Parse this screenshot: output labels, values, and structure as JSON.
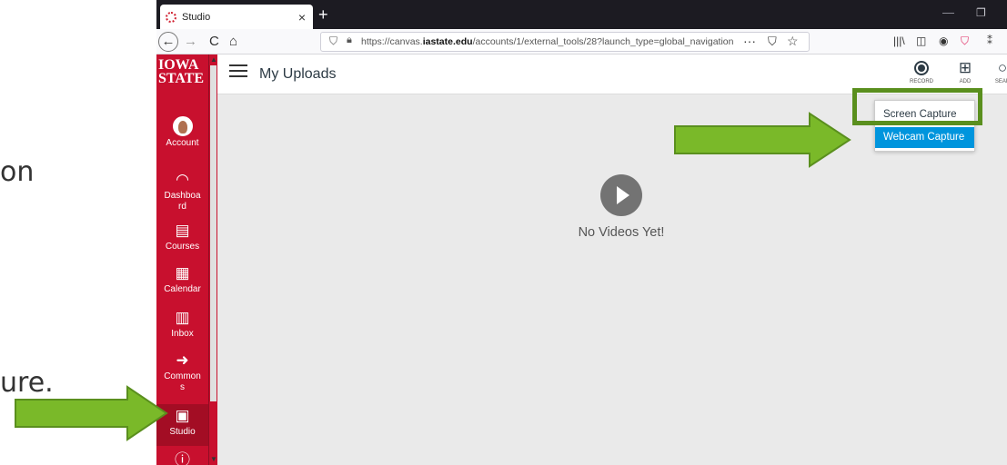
{
  "slide": {
    "fragment_top": "on",
    "fragment_bottom": "ure."
  },
  "browser": {
    "tab_title": "Studio",
    "tab_close": "×",
    "new_tab": "+",
    "min": "—",
    "max": "❐",
    "nav": {
      "back": "←",
      "forward": "→",
      "reload": "C",
      "home": "⌂"
    },
    "url_prefix": "https://canvas.",
    "url_domain": "iastate.edu",
    "url_suffix": "/accounts/1/external_tools/28?launch_type=global_navigation",
    "url_more": "···",
    "toolbar_icons": [
      "library-icon",
      "sidebar-icon",
      "account-icon",
      "pocket-icon",
      "extension-icon"
    ]
  },
  "canvas_nav": {
    "logo_line1": "IOWA",
    "logo_line2": "STATE",
    "items": [
      {
        "label": "Account",
        "icon": "avatar"
      },
      {
        "label": "Dashboa\nrd",
        "icon": "dashboard-icon"
      },
      {
        "label": "Courses",
        "icon": "courses-icon"
      },
      {
        "label": "Calendar",
        "icon": "calendar-icon"
      },
      {
        "label": "Inbox",
        "icon": "inbox-icon"
      },
      {
        "label": "Common\ns",
        "icon": "commons-icon"
      },
      {
        "label": "Studio",
        "icon": "studio-icon"
      },
      {
        "label": "",
        "icon": "help-icon"
      }
    ]
  },
  "header": {
    "title": "My Uploads",
    "record_label": "RECORD",
    "add_label": "ADD",
    "search_label": "SEAR"
  },
  "record_menu": {
    "items": [
      "Screen Capture",
      "Webcam Capture"
    ]
  },
  "empty_state": {
    "message": "No Videos Yet!"
  },
  "colors": {
    "canvas_red": "#c8102e",
    "arrow_green": "#7ab929",
    "menu_highlight": "#0095dd"
  }
}
